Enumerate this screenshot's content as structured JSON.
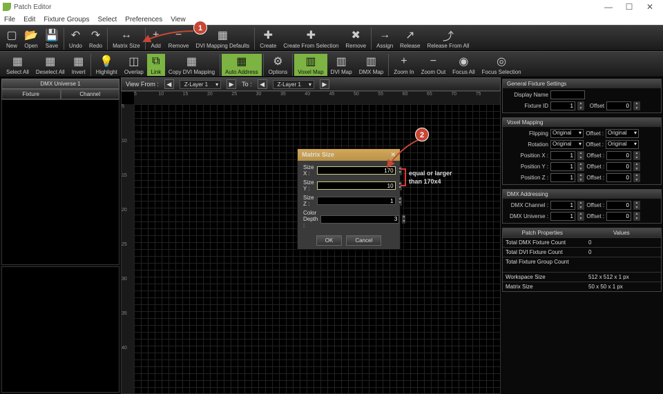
{
  "window": {
    "title": "Patch Editor",
    "min": "—",
    "max": "☐",
    "close": "✕"
  },
  "menu": [
    "File",
    "Edit",
    "Fixture Groups",
    "Select",
    "Preferences",
    "View"
  ],
  "toolbar1": [
    {
      "label": "New",
      "icon": "▢"
    },
    {
      "label": "Open",
      "icon": "📂"
    },
    {
      "label": "Save",
      "icon": "💾"
    },
    "|",
    {
      "label": "Undo",
      "icon": "↶"
    },
    {
      "label": "Redo",
      "icon": "↷"
    },
    "|",
    {
      "label": "Matrix Size",
      "icon": "↔"
    },
    "|",
    {
      "label": "Add",
      "icon": "+"
    },
    {
      "label": "Remove",
      "icon": "−"
    },
    {
      "label": "DVI Mapping Defaults",
      "icon": "▦"
    },
    "|",
    {
      "label": "Create",
      "icon": "✚"
    },
    {
      "label": "Create From Selection",
      "icon": "✚"
    },
    {
      "label": "Remove",
      "icon": "✖"
    },
    "|",
    {
      "label": "Assign",
      "icon": "→"
    },
    {
      "label": "Release",
      "icon": "↗"
    },
    {
      "label": "Release From All",
      "icon": "⤴"
    }
  ],
  "toolbar2": [
    {
      "label": "Select All",
      "icon": "▦"
    },
    {
      "label": "Deselect All",
      "icon": "▦"
    },
    {
      "label": "Invert",
      "icon": "▦"
    },
    "|",
    {
      "label": "Highlight",
      "icon": "💡"
    },
    {
      "label": "Overlap",
      "icon": "◫"
    },
    {
      "label": "Link",
      "icon": "⧉",
      "active": true
    },
    {
      "label": "Copy DVI Mapping",
      "icon": "▦"
    },
    "|",
    {
      "label": "Auto Address",
      "icon": "▦",
      "active": true
    },
    "|",
    {
      "label": "Options",
      "icon": "⚙"
    },
    "|",
    {
      "label": "Voxel Map",
      "icon": "▥",
      "active": true
    },
    {
      "label": "DVI Map",
      "icon": "▥"
    },
    {
      "label": "DMX Map",
      "icon": "▥"
    },
    "|",
    {
      "label": "Zoom In",
      "icon": "+"
    },
    {
      "label": "Zoom Out",
      "icon": "−"
    },
    {
      "label": "Focus All",
      "icon": "◉"
    },
    {
      "label": "Focus Selection",
      "icon": "◎"
    }
  ],
  "left": {
    "universe": "DMX Universe 1",
    "tabs": [
      "Fixture",
      "Channel"
    ]
  },
  "viewbar": {
    "label": "View From :",
    "layer1": "Z-Layer 1",
    "to": "To :",
    "layer2": "Z-Layer 1"
  },
  "rulerH": [
    "5",
    "10",
    "15",
    "20",
    "25",
    "30",
    "35",
    "40",
    "45",
    "50",
    "55",
    "60",
    "65",
    "70",
    "75"
  ],
  "rulerV": [
    "5",
    "10",
    "15",
    "20",
    "25",
    "30",
    "35",
    "40"
  ],
  "dialog": {
    "title": "Matrix Size",
    "close": "✕",
    "rows": [
      {
        "label": "Size X :",
        "value": "170"
      },
      {
        "label": "Size Y :",
        "value": "10"
      },
      {
        "label": "Size Z :",
        "value": "1"
      },
      {
        "label": "Color Depth :",
        "value": "3"
      }
    ],
    "ok": "OK",
    "cancel": "Cancel"
  },
  "annotation": {
    "text1": "equal or larger",
    "text2": "than 170x4",
    "c1": "1",
    "c2": "2"
  },
  "right": {
    "gfs": {
      "title": "General Fixture Settings",
      "display": "Display Name",
      "fid": "Fixture ID",
      "fid_v": "1",
      "offset": "Offset",
      "offset_v": "0"
    },
    "vm": {
      "title": "Voxel Mapping",
      "rows": [
        {
          "l": "Flipping",
          "v": "Original",
          "l2": "Offset :",
          "v2": "Original"
        },
        {
          "l": "Rotation",
          "v": "Original",
          "l2": "Offset :",
          "v2": "Original"
        },
        {
          "l": "Position X :",
          "v": "1",
          "l2": "Offset :",
          "v2": "0"
        },
        {
          "l": "Position Y :",
          "v": "1",
          "l2": "Offset :",
          "v2": "0"
        },
        {
          "l": "Position Z :",
          "v": "1",
          "l2": "Offset :",
          "v2": "0"
        }
      ]
    },
    "dmx": {
      "title": "DMX Addressing",
      "rows": [
        {
          "l": "DMX Channel :",
          "v": "1",
          "l2": "Offset :",
          "v2": "0"
        },
        {
          "l": "DMX Universe :",
          "v": "1",
          "l2": "Offset :",
          "v2": "0"
        }
      ]
    },
    "props": {
      "h1": "Patch Properties",
      "h2": "Values",
      "rows": [
        {
          "k": "Total DMX Fixture Count",
          "v": "0"
        },
        {
          "k": "Total DVI Fixture Count",
          "v": "0"
        },
        {
          "k": "Total Fixture Group Count",
          "v": ""
        },
        {
          "k": "Workspace Size",
          "v": "512 x 512 x 1 px"
        },
        {
          "k": "Matrix Size",
          "v": "50 x 50 x 1 px"
        }
      ]
    }
  }
}
